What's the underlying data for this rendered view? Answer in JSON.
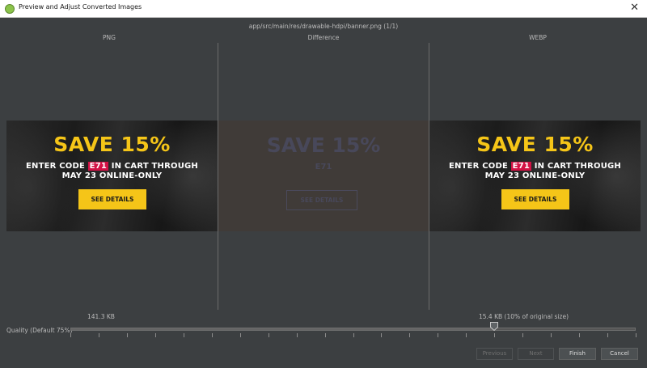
{
  "window": {
    "title": "Preview and Adjust Converted Images"
  },
  "header": {
    "file_path": "app/src/main/res/drawable-hdpi/banner.png (1/1)"
  },
  "columns": {
    "png": "PNG",
    "difference": "Difference",
    "webp": "WEBP"
  },
  "banner": {
    "headline": "SAVE 15%",
    "line1_pre": "ENTER CODE ",
    "code": "E71",
    "line1_post": " IN CART THROUGH",
    "line2": "MAY 23 ONLINE-ONLY",
    "button": "SEE DETAILS"
  },
  "difference_preview": {
    "headline": "SAVE 15%",
    "code_text": "E71",
    "button": "SEE DETAILS"
  },
  "sizes": {
    "png": "141.3 KB",
    "webp": "15.4 KB (10% of original size)"
  },
  "quality": {
    "label": "Quality (Default 75%)",
    "value": 75,
    "min": 0,
    "max": 100
  },
  "buttons": {
    "previous": "Previous",
    "next": "Next",
    "finish": "Finish",
    "cancel": "Cancel"
  },
  "colors": {
    "background": "#3c3f41",
    "accent_yellow": "#f5c518",
    "code_red": "#d31145"
  }
}
